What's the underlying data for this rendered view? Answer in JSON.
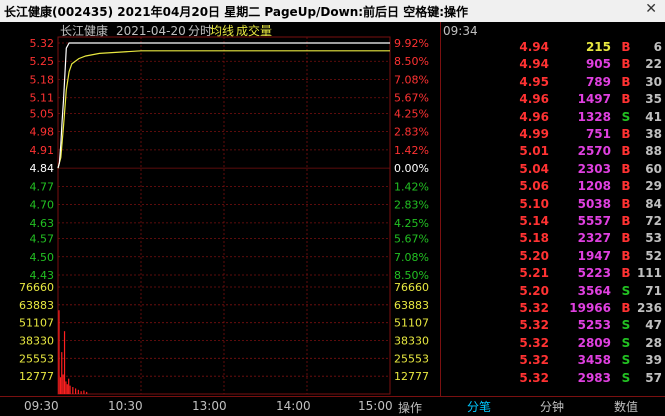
{
  "window": {
    "title": "长江健康(002435)  2021年04月20日 星期二 PageUp/Down:前后日 空格键:操作",
    "close_label": "✕"
  },
  "chart_header": {
    "name": "长江健康",
    "date": "2021-04-20",
    "mode": "分时",
    "avg_label": "均线",
    "vol_label": "成交量"
  },
  "colors": {
    "up": "#ff3232",
    "down": "#22c022",
    "flat": "#ffffff",
    "price_line": "#ffffff",
    "avg_line": "#e8e840",
    "volume": "#ff2020",
    "grid": "#7a1010",
    "buy": "#ff3232",
    "sell": "#22c022",
    "volume_pink": "#e040e0",
    "volume_yellow": "#e8e840"
  },
  "chart_data": {
    "type": "line",
    "prev_close": 4.84,
    "price_ticks_left": [
      "5.32",
      "5.25",
      "5.18",
      "5.11",
      "5.05",
      "4.98",
      "4.91",
      "4.84",
      "4.77",
      "4.70",
      "4.63",
      "4.57",
      "4.50",
      "4.43"
    ],
    "pct_ticks_right": [
      "9.92%",
      "8.50%",
      "7.08%",
      "5.67%",
      "4.25%",
      "2.83%",
      "1.42%",
      "0.00%",
      "1.42%",
      "2.83%",
      "4.25%",
      "5.67%",
      "7.08%",
      "8.50%"
    ],
    "volume_ticks": [
      "76660",
      "63883",
      "51107",
      "38330",
      "25553",
      "12777"
    ],
    "ylim_price": [
      4.43,
      5.32
    ],
    "ylim_volume": [
      0,
      76660
    ],
    "x_ticks": [
      "09:30",
      "10:30",
      "13:00",
      "14:00",
      "15:00"
    ],
    "series": [
      {
        "name": "price",
        "x": [
          0,
          1,
          2,
          3,
          4,
          5,
          6,
          8,
          10,
          15,
          20,
          30,
          60,
          120,
          180,
          240
        ],
        "values": [
          4.84,
          4.86,
          4.93,
          5.02,
          5.1,
          5.2,
          5.3,
          5.32,
          5.32,
          5.32,
          5.32,
          5.32,
          5.32,
          5.32,
          5.32,
          5.32
        ]
      },
      {
        "name": "均线",
        "x": [
          0,
          2,
          4,
          6,
          8,
          10,
          15,
          20,
          30,
          60,
          120,
          180,
          240
        ],
        "values": [
          4.84,
          4.88,
          5.0,
          5.14,
          5.21,
          5.24,
          5.26,
          5.27,
          5.28,
          5.29,
          5.29,
          5.29,
          5.29
        ]
      },
      {
        "name": "成交量",
        "x": [
          0,
          1,
          2,
          3,
          4,
          5,
          6,
          7,
          8,
          10,
          12,
          14,
          16,
          18,
          20
        ],
        "values": [
          60000,
          12000,
          30000,
          14000,
          45000,
          9000,
          7000,
          11000,
          6000,
          5000,
          4000,
          3000,
          2000,
          2500,
          1500
        ]
      }
    ]
  },
  "ticks_panel": {
    "time": "09:34",
    "rows": [
      {
        "price": "4.94",
        "vol": "215",
        "side": "B",
        "n": "6"
      },
      {
        "price": "4.94",
        "vol": "905",
        "side": "B",
        "n": "22"
      },
      {
        "price": "4.95",
        "vol": "789",
        "side": "B",
        "n": "30"
      },
      {
        "price": "4.96",
        "vol": "1497",
        "side": "B",
        "n": "35"
      },
      {
        "price": "4.96",
        "vol": "1328",
        "side": "S",
        "n": "41"
      },
      {
        "price": "4.99",
        "vol": "751",
        "side": "B",
        "n": "38"
      },
      {
        "price": "5.01",
        "vol": "2570",
        "side": "B",
        "n": "88"
      },
      {
        "price": "5.04",
        "vol": "2303",
        "side": "B",
        "n": "60"
      },
      {
        "price": "5.06",
        "vol": "1208",
        "side": "B",
        "n": "29"
      },
      {
        "price": "5.10",
        "vol": "5038",
        "side": "B",
        "n": "84"
      },
      {
        "price": "5.14",
        "vol": "5557",
        "side": "B",
        "n": "72"
      },
      {
        "price": "5.18",
        "vol": "2327",
        "side": "B",
        "n": "53"
      },
      {
        "price": "5.20",
        "vol": "1947",
        "side": "B",
        "n": "52"
      },
      {
        "price": "5.21",
        "vol": "5223",
        "side": "B",
        "n": "111"
      },
      {
        "price": "5.20",
        "vol": "3564",
        "side": "S",
        "n": "71"
      },
      {
        "price": "5.32",
        "vol": "19966",
        "side": "B",
        "n": "236"
      },
      {
        "price": "5.32",
        "vol": "5253",
        "side": "S",
        "n": "47"
      },
      {
        "price": "5.32",
        "vol": "2809",
        "side": "S",
        "n": "28"
      },
      {
        "price": "5.32",
        "vol": "3458",
        "side": "S",
        "n": "39"
      },
      {
        "price": "5.32",
        "vol": "2983",
        "side": "S",
        "n": "57"
      }
    ]
  },
  "bottom": {
    "op_label": "操作",
    "tabs": [
      "分笔",
      "分钟",
      "数值"
    ]
  }
}
